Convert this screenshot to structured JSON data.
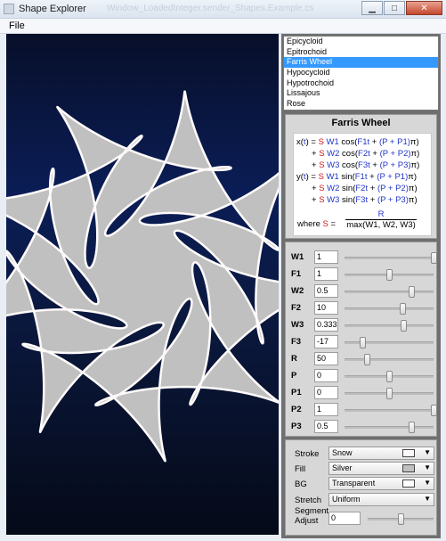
{
  "window": {
    "title": "Shape Explorer",
    "ghost_title": "Window_LoadedInteger.sender_Shapes.Example.cs"
  },
  "menu": {
    "file_label": "File"
  },
  "shape_list": {
    "items": [
      "Epicycloid",
      "Epitrochoid",
      "Farris Wheel",
      "Hypocycloid",
      "Hypotrochoid",
      "Lissajous",
      "Rose"
    ],
    "selected": "Farris Wheel"
  },
  "formula": {
    "title": "Farris Wheel",
    "x_line1": {
      "pre": "x(",
      "t": "t",
      "mid": ") = ",
      "s": "S",
      "w": " W1",
      "cos": " cos(",
      "f": "F1t",
      "plus": " + ",
      "p": "(P + P1)",
      "pi": "π)"
    },
    "x_line2": {
      "lead": "+ ",
      "s": "S",
      "w": " W2",
      "cos": " cos(",
      "f": "F2t",
      "plus": " + ",
      "p": "(P + P2)",
      "pi": "π)"
    },
    "x_line3": {
      "lead": "+ ",
      "s": "S",
      "w": " W3",
      "cos": " cos(",
      "f": "F3t",
      "plus": " + ",
      "p": "(P + P3)",
      "pi": "π)"
    },
    "y_line1": {
      "pre": "y(",
      "t": "t",
      "mid": ") = ",
      "s": "S",
      "w": " W1",
      "sin": " sin(",
      "f": "F1t",
      "plus": " + ",
      "p": "(P + P1)",
      "pi": "π)"
    },
    "y_line2": {
      "lead": "+ ",
      "s": "S",
      "w": " W2",
      "sin": " sin(",
      "f": "F2t",
      "plus": " + ",
      "p": "(P + P2)",
      "pi": "π)"
    },
    "y_line3": {
      "lead": "+ ",
      "s": "S",
      "w": " W3",
      "sin": " sin(",
      "f": "F3t",
      "plus": " + ",
      "p": "(P + P3)",
      "pi": "π)"
    },
    "where": "where ",
    "where_s": "S",
    "where_eq": " =",
    "numerator": "R",
    "denominator": "max(W1, W2, W3)"
  },
  "params": [
    {
      "label": "W1",
      "value": "1",
      "slider": 1.0
    },
    {
      "label": "F1",
      "value": "1",
      "slider": 0.5
    },
    {
      "label": "W2",
      "value": "0.5",
      "slider": 0.75
    },
    {
      "label": "F2",
      "value": "10",
      "slider": 0.65
    },
    {
      "label": "W3",
      "value": "0.3333",
      "slider": 0.66
    },
    {
      "label": "F3",
      "value": "-17",
      "slider": 0.2
    },
    {
      "label": "R",
      "value": "50",
      "slider": 0.25
    },
    {
      "label": "P",
      "value": "0",
      "slider": 0.5
    },
    {
      "label": "P1",
      "value": "0",
      "slider": 0.5
    },
    {
      "label": "P2",
      "value": "1",
      "slider": 1.0
    },
    {
      "label": "P3",
      "value": "0.5",
      "slider": 0.75
    }
  ],
  "style": {
    "stroke": {
      "label": "Stroke",
      "value": "Snow",
      "color": "#fffafa"
    },
    "fill": {
      "label": "Fill",
      "value": "Silver",
      "color": "#c0c0c0"
    },
    "bg": {
      "label": "BG",
      "value": "Transparent",
      "color": "#ffffff"
    },
    "stretch": {
      "label": "Stretch",
      "value": "Uniform"
    },
    "segment": {
      "label_line1": "Segment",
      "label_line2": "Adjust",
      "value": "0",
      "slider": 0.5
    }
  },
  "shape_colors": {
    "fill": "#c0c0c0",
    "stroke": "#fffafa"
  }
}
